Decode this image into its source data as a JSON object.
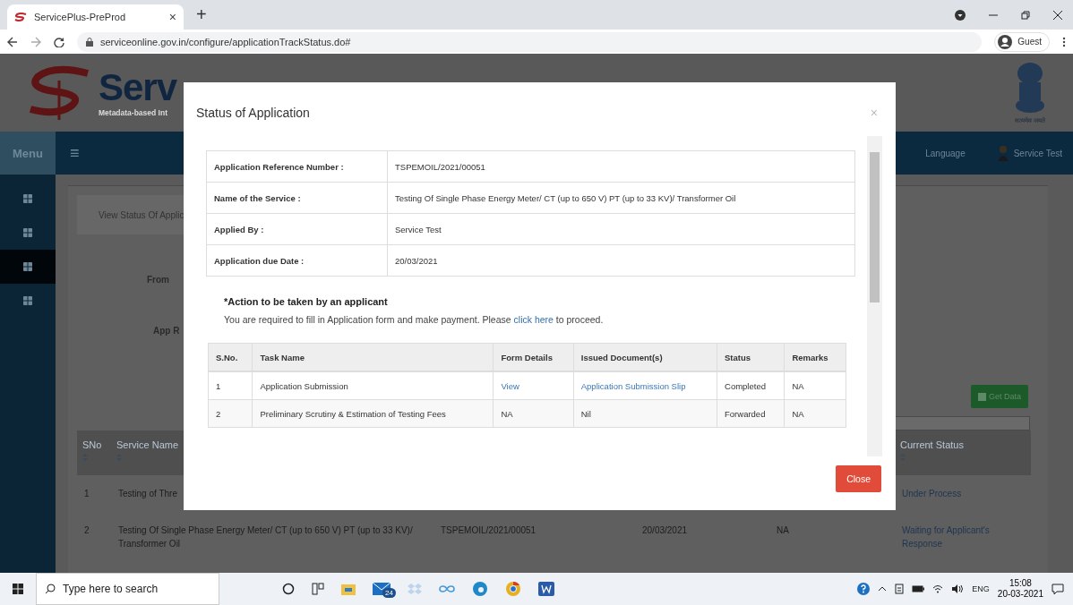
{
  "browser": {
    "tab_title": "ServicePlus-PreProd",
    "tab_close": "×",
    "new_tab": "+",
    "url": "serviceonline.gov.in/configure/applicationTrackStatus.do#",
    "profile": "Guest"
  },
  "header": {
    "logo_text": "Serv",
    "logo_tagline": "Metadata-based Int",
    "emblem_caption": "सत्यमेव जयते"
  },
  "navbar": {
    "menu": "Menu",
    "hamburger": "≡",
    "language": "Language",
    "user": "Service Test"
  },
  "sidebar": {
    "items": [
      {
        "selected": false
      },
      {
        "selected": false
      },
      {
        "selected": true
      },
      {
        "selected": false
      }
    ]
  },
  "page": {
    "tab": "View Status Of Applic",
    "from_label": "From",
    "app_ref_label": "App R",
    "get_data_button": "Get Data",
    "table": {
      "header": {
        "sno": "SNo",
        "service_name": "Service Name",
        "current_status": "Current Status"
      },
      "rows": [
        {
          "sno": "1",
          "service_name": "Testing of Thre",
          "current_status": "Under Process"
        },
        {
          "sno": "2",
          "service_name": "Testing Of Single Phase Energy Meter/ CT (up to 650 V) PT (up to 33 KV)/ Transformer Oil",
          "column_3": "TSPEMOIL/2021/00051",
          "column_4": "20/03/2021",
          "column_5": "NA",
          "current_status": "Waiting for Applicant's Response"
        }
      ]
    }
  },
  "modal": {
    "title": "Status of Application",
    "close_icon": "×",
    "details": [
      {
        "label": "Application Reference Number :",
        "value": "TSPEMOIL/2021/00051"
      },
      {
        "label": "Name of the Service :",
        "value": "Testing Of Single Phase Energy Meter/ CT (up to 650 V) PT (up to 33 KV)/ Transformer Oil"
      },
      {
        "label": "Applied By :",
        "value": "Service Test"
      },
      {
        "label": "Application due Date :",
        "value": "20/03/2021"
      }
    ],
    "action_heading": "*Action to be taken by an applicant",
    "action_text_before": "You are required to fill in Application form and make payment. Please",
    "action_link": "click here",
    "action_text_after": "to proceed.",
    "tasks": {
      "columns": [
        "S.No.",
        "Task Name",
        "Form Details",
        "Issued Document(s)",
        "Status",
        "Remarks"
      ],
      "rows": [
        {
          "cells": [
            {
              "kind": "text",
              "text": "1"
            },
            {
              "kind": "text",
              "text": "Application Submission"
            },
            {
              "kind": "link",
              "text": "View"
            },
            {
              "kind": "link",
              "text": "Application Submission Slip"
            },
            {
              "kind": "text",
              "text": "Completed"
            },
            {
              "kind": "text",
              "text": "NA"
            }
          ]
        },
        {
          "cells": [
            {
              "kind": "text",
              "text": "2"
            },
            {
              "kind": "text",
              "text": "Preliminary Scrutiny & Estimation of Testing Fees"
            },
            {
              "kind": "text",
              "text": "NA"
            },
            {
              "kind": "text",
              "text": "Nil"
            },
            {
              "kind": "text",
              "text": "Forwarded"
            },
            {
              "kind": "text",
              "text": "NA"
            }
          ]
        }
      ]
    },
    "close_button": "Close"
  },
  "taskbar": {
    "search_placeholder": "Type here to search",
    "mail_badge": "24",
    "language": "ENG",
    "time": "15:08",
    "date": "20-03-2021"
  }
}
